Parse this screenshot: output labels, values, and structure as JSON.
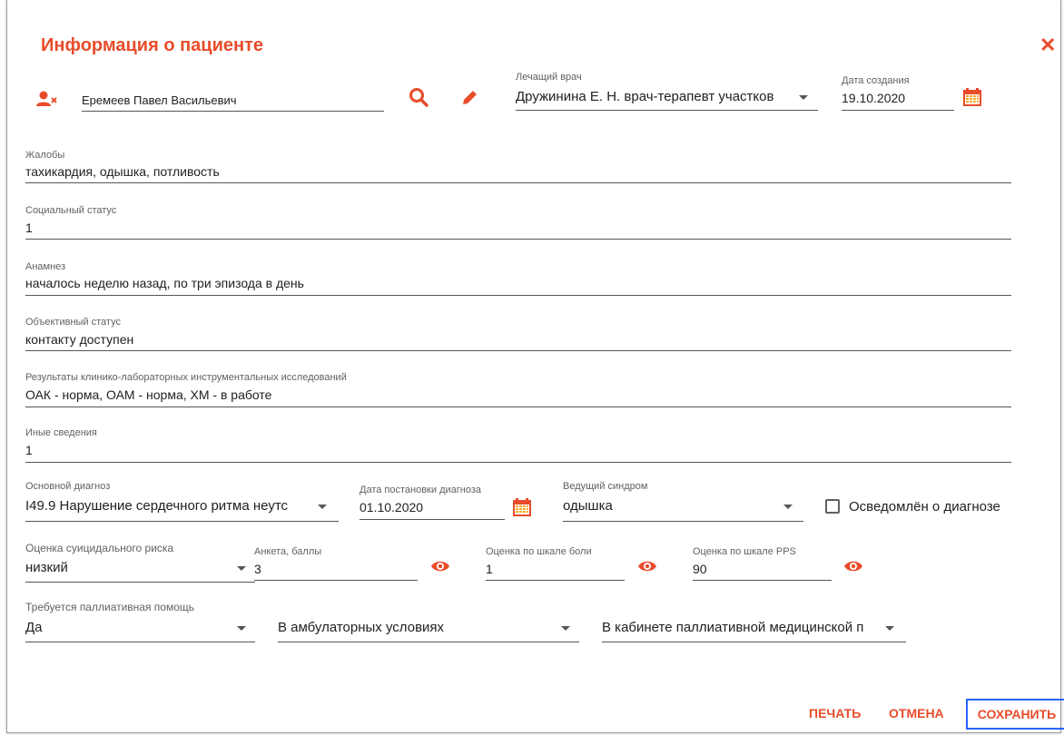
{
  "dialog": {
    "title": "Информация о пациенте",
    "close_glyph": "✕"
  },
  "patient": {
    "name": "Еремеев Павел Васильевич"
  },
  "doctor": {
    "label": "Лечащий врач",
    "value": "Дружинина Е. Н. врач-терапевт участков"
  },
  "created": {
    "label": "Дата создания",
    "value": "19.10.2020"
  },
  "fields": {
    "complaints": {
      "label": "Жалобы",
      "value": "тахикардия, одышка, потливость"
    },
    "social": {
      "label": "Социальный статус",
      "value": "1"
    },
    "anamnesis": {
      "label": "Анамнез",
      "value": "началось неделю назад, по три эпизода в день"
    },
    "objective": {
      "label": "Объективный статус",
      "value": "контакту доступен"
    },
    "results": {
      "label": "Результаты клинико-лабораторных инструментальных исследований",
      "value": "ОАК - норма, ОАМ - норма, ХМ - в работе"
    },
    "other": {
      "label": "Иные сведения",
      "value": "1"
    }
  },
  "diagnosis": {
    "main_label": "Основной диагноз",
    "main_value": "I49.9 Нарушение сердечного ритма неутс",
    "date_label": "Дата постановки диагноза",
    "date_value": "01.10.2020",
    "syndrome_label": "Ведущий синдром",
    "syndrome_value": "одышка",
    "aware_label": "Осведомлён о диагнозе"
  },
  "risk": {
    "suicide_label": "Оценка суицидального риска",
    "suicide_value": "низкий",
    "survey_label": "Анкета, баллы",
    "survey_value": "3",
    "pain_label": "Оценка по шкале боли",
    "pain_value": "1",
    "pps_label": "Оценка по шкале PPS",
    "pps_value": "90"
  },
  "palliative": {
    "label": "Требуется паллиативная помощь",
    "need_value": "Да",
    "condition_value": "В амбулаторных условиях",
    "place_value": "В кабинете паллиативной медицинской п"
  },
  "buttons": {
    "print": "ПЕЧАТЬ",
    "cancel": "ОТМЕНА",
    "save": "СОХРАНИТЬ"
  },
  "colors": {
    "accent": "#e84c2b",
    "focus": "#2962ff",
    "icon_yellow": "#f9a825"
  },
  "icons": [
    "remove-user-icon",
    "search-icon",
    "pencil-icon",
    "calendar-icon",
    "chevron-down-icon",
    "eye-icon",
    "close-icon"
  ]
}
